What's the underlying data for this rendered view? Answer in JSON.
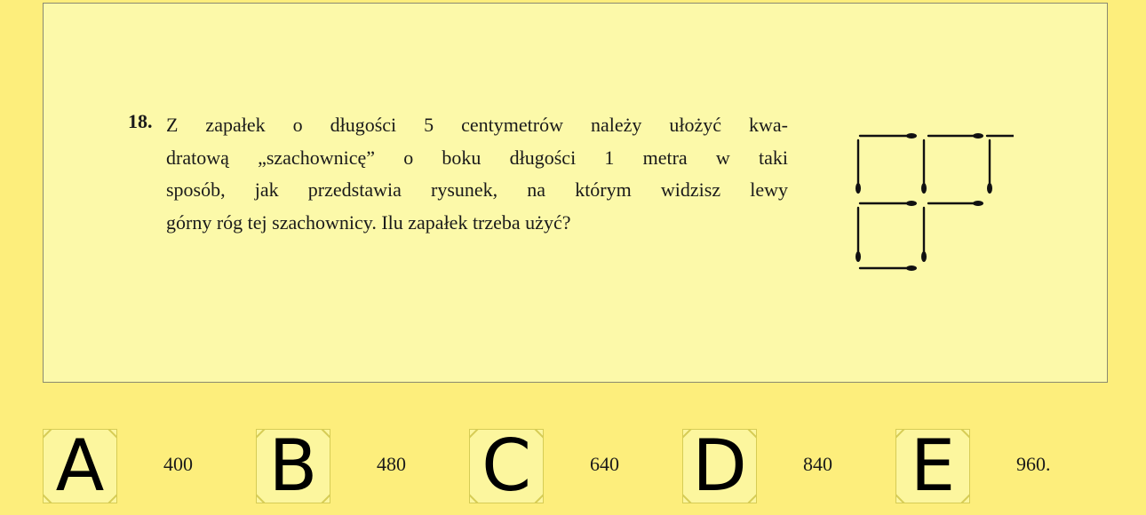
{
  "question": {
    "number": "18.",
    "lines": [
      "Z zapałek o długości 5 centymetrów należy ułożyć kwa-",
      "dratową „szachownicę” o boku długości 1 metra w taki",
      "sposób, jak przedstawia rysunek, na którym widzisz lewy",
      "górny róg tej szachownicy. Ilu zapałek trzeba użyć?"
    ]
  },
  "answers": [
    {
      "letter": "A",
      "value": "400"
    },
    {
      "letter": "B",
      "value": "480"
    },
    {
      "letter": "C",
      "value": "640"
    },
    {
      "letter": "D",
      "value": "840"
    },
    {
      "letter": "E",
      "value": "960."
    }
  ],
  "colors": {
    "page_background": "#fdee7c",
    "panel_background": "#fcf9a9",
    "answer_box_background": "#fcf69e",
    "answer_box_border": "#d6cc55",
    "match_color": "#111111"
  }
}
